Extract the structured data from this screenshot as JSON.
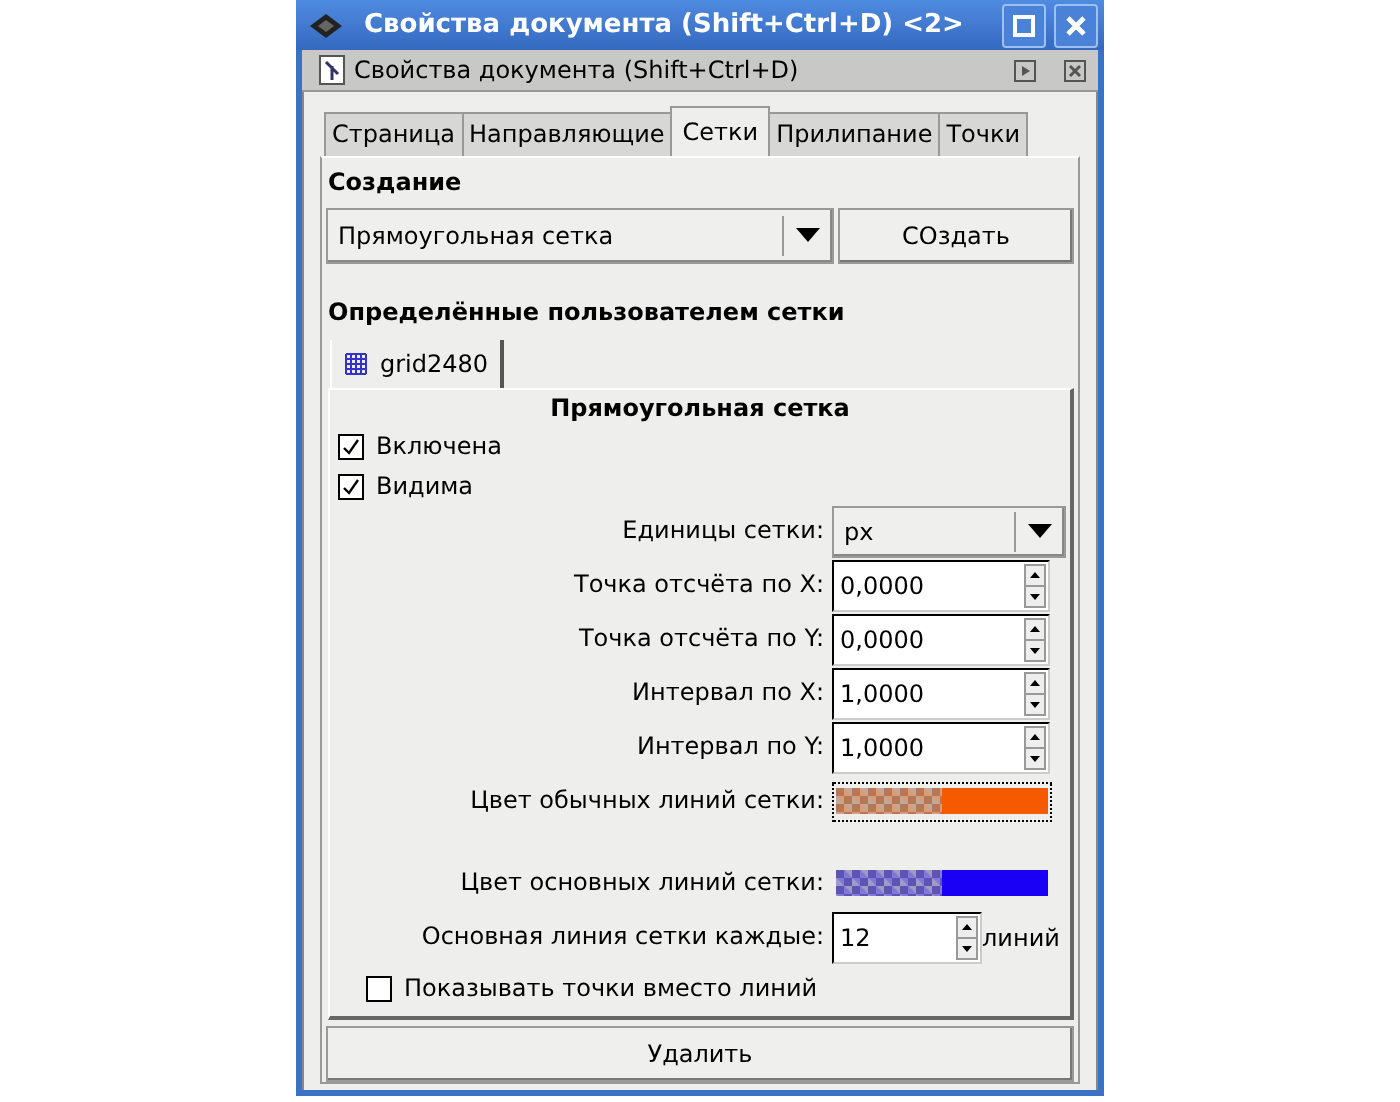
{
  "window": {
    "title": "Свойства документа (Shift+Ctrl+D) <2>"
  },
  "dock_title": "Свойства документа (Shift+Ctrl+D)",
  "tabs": [
    {
      "label": "Страница",
      "selected": false
    },
    {
      "label": "Направляющие",
      "selected": false
    },
    {
      "label": "Сетки",
      "selected": true
    },
    {
      "label": "Прилипание",
      "selected": false
    },
    {
      "label": "Точки",
      "selected": false
    }
  ],
  "create_section": {
    "heading": "Создание",
    "grid_type": "Прямоугольная сетка",
    "button": "СОздать"
  },
  "user_grids": {
    "heading": "Определённые пользователем сетки",
    "grid_tabs": [
      {
        "label": "grid2480",
        "selected": true
      }
    ],
    "panel_title": "Прямоугольная сетка",
    "checkboxes": [
      {
        "label": "Включена",
        "checked": true
      },
      {
        "label": "Видима",
        "checked": true
      }
    ],
    "fields": [
      {
        "kind": "dropdown",
        "label": "Единицы сетки:",
        "value": "px"
      },
      {
        "kind": "spin",
        "label": "Точка отсчёта по X:",
        "value": "0,0000"
      },
      {
        "kind": "spin",
        "label": "Точка отсчёта по Y:",
        "value": "0,0000"
      },
      {
        "kind": "spin",
        "label": "Интервал по X:",
        "value": "1,0000"
      },
      {
        "kind": "spin",
        "label": "Интервал по Y:",
        "value": "1,0000"
      },
      {
        "kind": "color",
        "label": "Цвет обычных линий сетки:",
        "color": "#f55a00",
        "focused": true
      },
      {
        "kind": "color",
        "label": "Цвет основных линий сетки:",
        "color": "#1a00f5",
        "focused": false
      },
      {
        "kind": "spin",
        "label": "Основная линия сетки каждые:",
        "value": "12",
        "suffix": "линий"
      }
    ],
    "dots_option": {
      "label": "Показывать точки вместо линий",
      "checked": false
    },
    "delete_button": "Удалить"
  }
}
